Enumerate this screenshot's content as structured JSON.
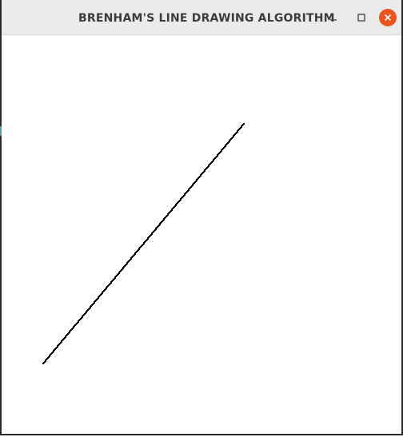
{
  "window": {
    "title": "BRENHAM'S LINE DRAWING ALGORITHM",
    "controls": {
      "minimize_icon": "minimize-icon",
      "maximize_icon": "maximize-icon",
      "close_icon": "close-icon"
    },
    "accent_close": "#e95420",
    "titlebar_bg": "#ebebeb"
  },
  "drawing": {
    "line_color": "#000000",
    "background": "#ffffff"
  }
}
